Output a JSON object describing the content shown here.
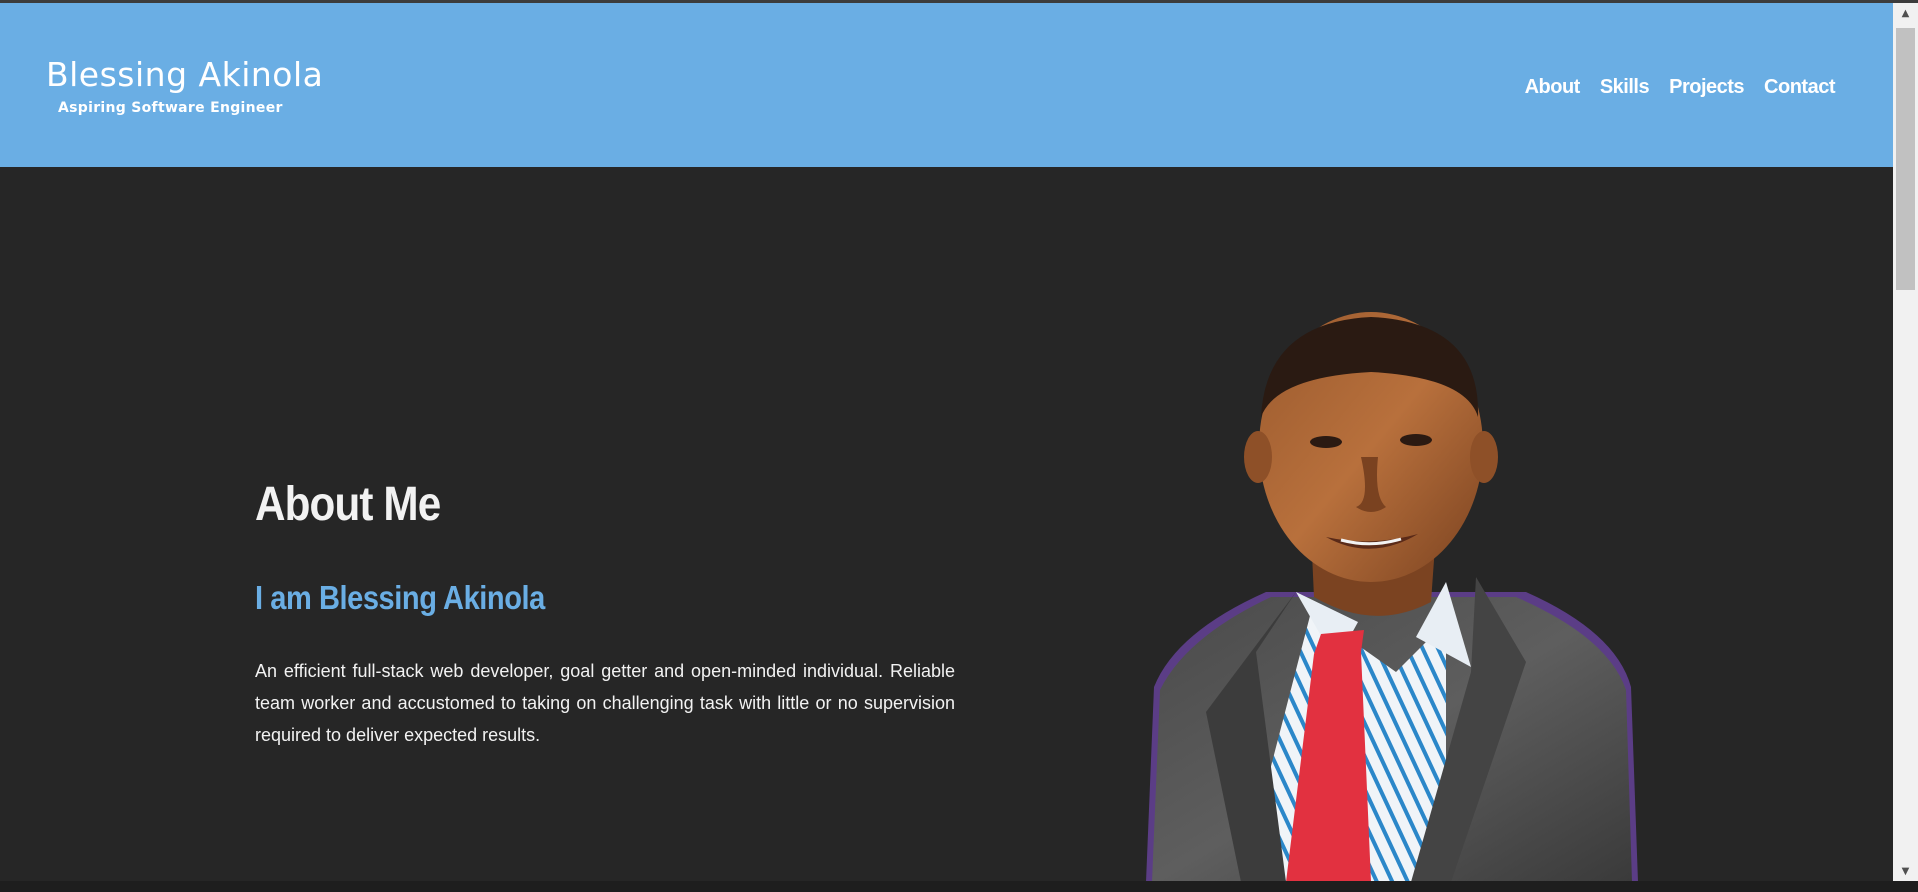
{
  "header": {
    "brand_name": "Blessing Akinola",
    "brand_tagline": "Aspiring Software Engineer",
    "nav": [
      "About",
      "Skills",
      "Projects",
      "Contact"
    ]
  },
  "about": {
    "title": "About Me",
    "subtitle": "I am Blessing Akinola",
    "text": "An efficient full-stack web developer, goal getter and open-minded individual. Reliable team worker and accustomed to taking on challenging task with little or no supervision required to deliver expected results."
  },
  "colors": {
    "header_bg": "#6aaee4",
    "page_bg": "#262626",
    "accent": "#6aaee4",
    "text": "#f2f2f2"
  },
  "icons": [
    "chevron-up-icon",
    "chevron-down-icon"
  ]
}
